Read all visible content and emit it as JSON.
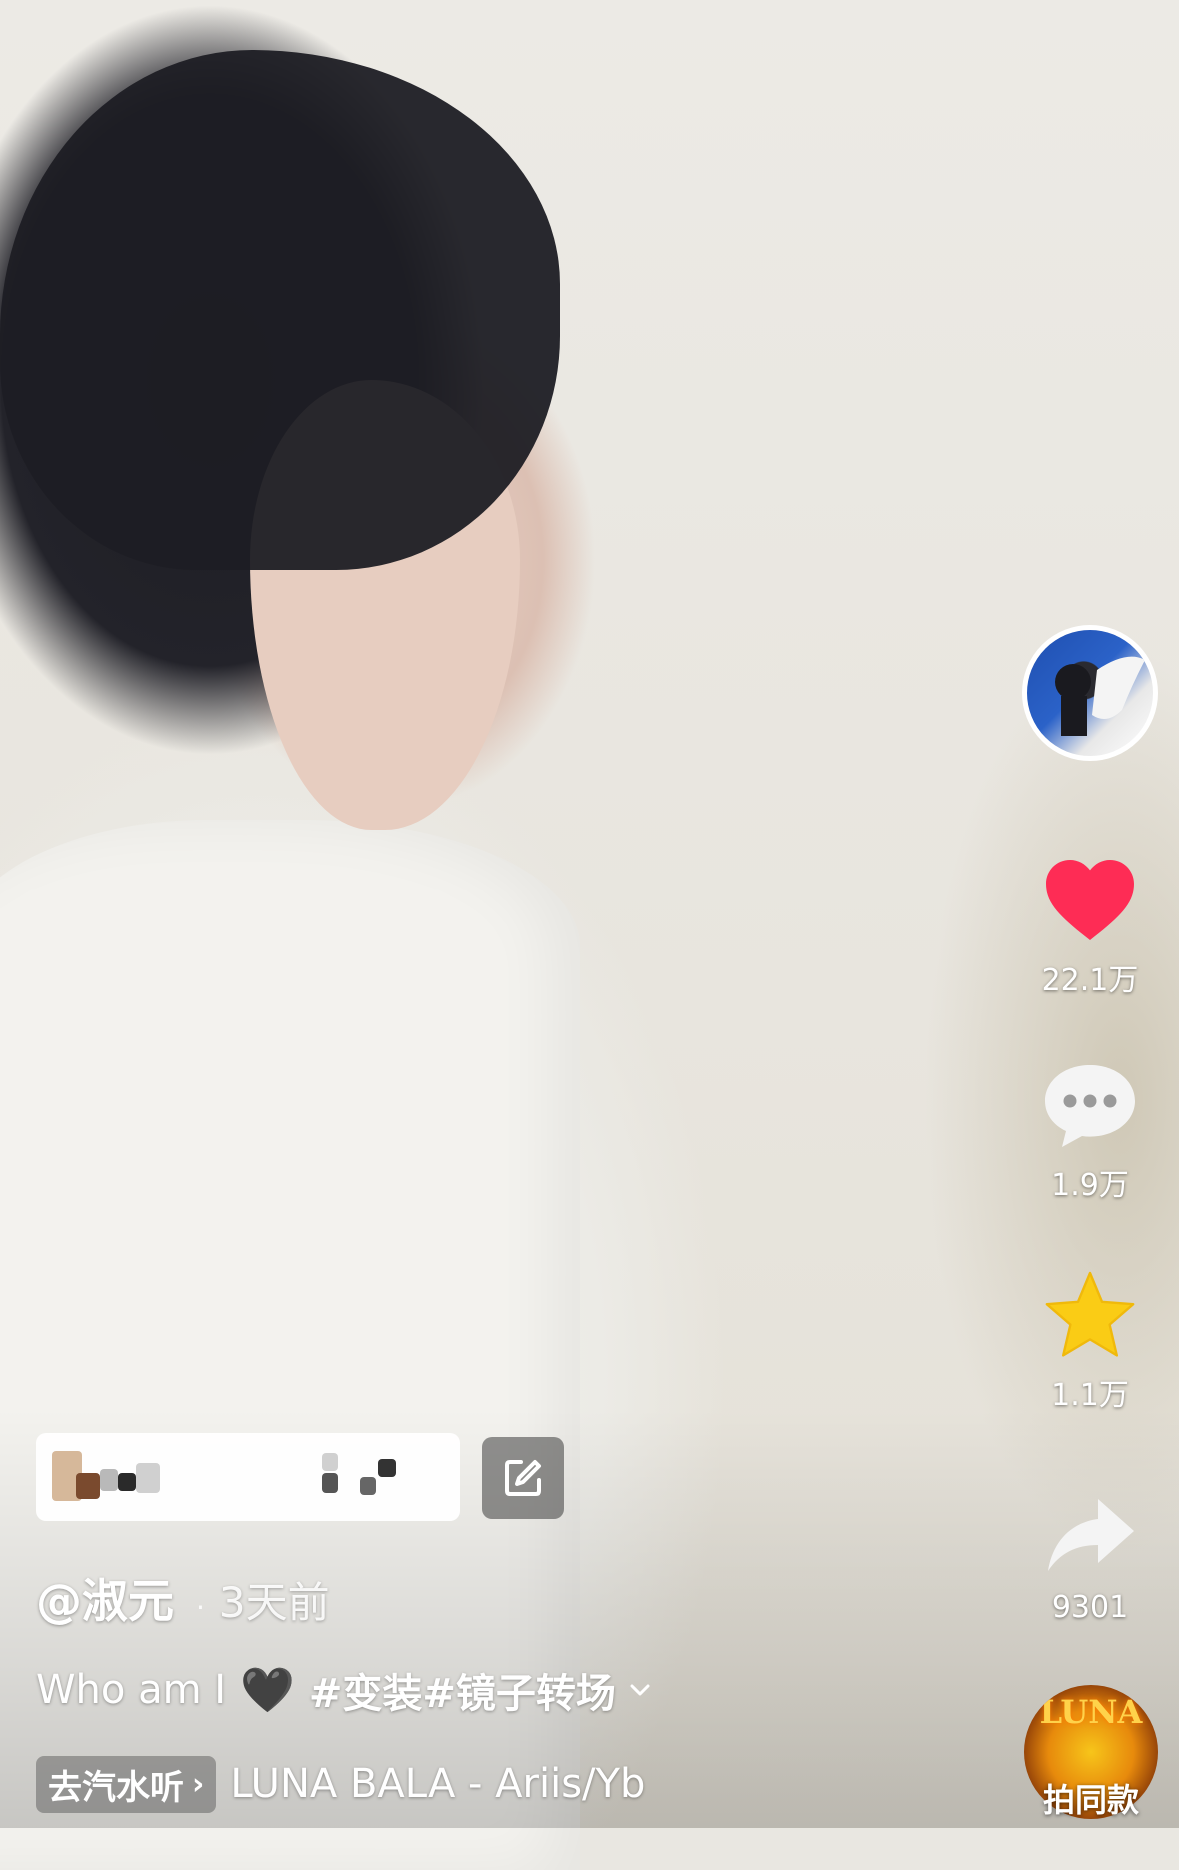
{
  "video": {
    "author": "@淑元",
    "posted_ago": "3天前",
    "caption": "Who am I",
    "caption_emoji": "🖤",
    "hashtags": "#变装#镜子转场"
  },
  "actions": {
    "like_count": "22.1万",
    "comment_count": "1.9万",
    "favorite_count": "1.1万",
    "share_count": "9301"
  },
  "music": {
    "listen_chip": "去汽水听",
    "track": "LUNA BALA - Ariis/Yb",
    "disc_title": "LUNA",
    "same_style_label": "拍同款"
  },
  "colors": {
    "like_red": "#fe2c55",
    "favorite_yellow": "#facc15"
  }
}
